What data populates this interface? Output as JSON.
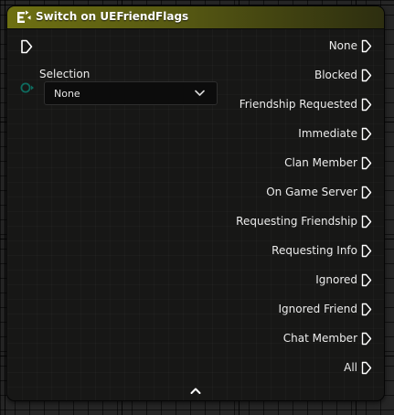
{
  "node": {
    "title": "Switch on UEFriendFlags",
    "header_icon": "switch-enum-icon",
    "input_exec_icon": "exec-pin-icon",
    "selection": {
      "label": "Selection",
      "pin_icon": "byte-pin-icon",
      "value": "None"
    },
    "outputs": [
      {
        "label": "None"
      },
      {
        "label": "Blocked"
      },
      {
        "label": "Friendship Requested"
      },
      {
        "label": "Immediate"
      },
      {
        "label": "Clan Member"
      },
      {
        "label": "On Game Server"
      },
      {
        "label": "Requesting Friendship"
      },
      {
        "label": "Requesting Info"
      },
      {
        "label": "Ignored"
      },
      {
        "label": "Ignored Friend"
      },
      {
        "label": "Chat Member"
      },
      {
        "label": "All"
      }
    ],
    "collapse_icon": "chevron-up-icon"
  },
  "colors": {
    "header_start": "#6e7012",
    "header_end": "#2d2e10",
    "enum_pin": "#0e6b5f",
    "exec_pin": "#ffffff",
    "background": "#262626"
  }
}
